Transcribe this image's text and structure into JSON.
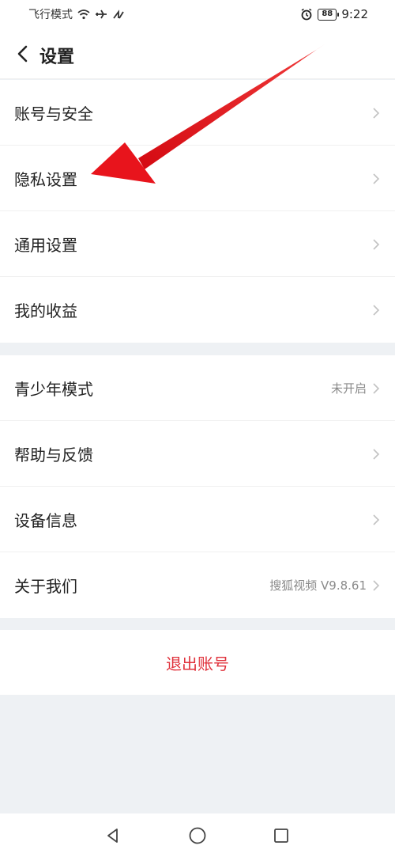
{
  "status_bar": {
    "carrier": "飞行模式",
    "battery": "88",
    "time": "9:22"
  },
  "header": {
    "title": "设置"
  },
  "group1": [
    {
      "label": "账号与安全"
    },
    {
      "label": "隐私设置"
    },
    {
      "label": "通用设置"
    },
    {
      "label": "我的收益"
    }
  ],
  "group2": [
    {
      "label": "青少年模式",
      "value": "未开启"
    },
    {
      "label": "帮助与反馈"
    },
    {
      "label": "设备信息"
    },
    {
      "label": "关于我们",
      "value": "搜狐视频 V9.8.61"
    }
  ],
  "logout_label": "退出账号",
  "colors": {
    "accent_red": "#e0323c",
    "annotation_arrow": "#e8141c",
    "page_bg": "#eef1f4"
  },
  "icons": [
    "wifi-icon",
    "airplane-icon",
    "signal-icon",
    "alarm-icon",
    "battery-icon",
    "back-icon",
    "chevron-right-icon",
    "nav-back-icon",
    "nav-home-icon",
    "nav-recents-icon"
  ]
}
